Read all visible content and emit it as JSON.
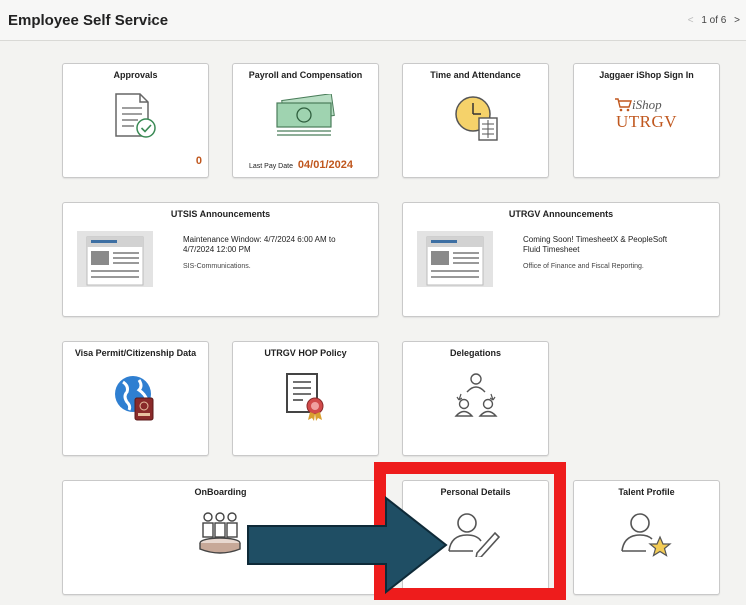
{
  "header": {
    "title": "Employee Self Service",
    "pager": "1 of 6"
  },
  "tiles": {
    "approvals": {
      "title": "Approvals",
      "count": "0"
    },
    "payroll": {
      "title": "Payroll and Compensation",
      "last_pay_label": "Last Pay Date",
      "last_pay_value": "04/01/2024"
    },
    "time": {
      "title": "Time and Attendance"
    },
    "jaggaer": {
      "title": "Jaggaer iShop Sign In",
      "logo_top": "iShop",
      "logo_bottom": "UTRGV"
    },
    "utsis": {
      "title": "UTSIS Announcements",
      "text": "Maintenance Window:  4/7/2024 6:00 AM to 4/7/2024 12:00 PM",
      "source": "SIS-Communications."
    },
    "utrgv_ann": {
      "title": "UTRGV Announcements",
      "text": "Coming Soon! TimesheetX & PeopleSoft Fluid Timesheet",
      "source": "Office of Finance and Fiscal Reporting."
    },
    "visa": {
      "title": "Visa Permit/Citizenship Data"
    },
    "hop": {
      "title": "UTRGV HOP Policy"
    },
    "delegations": {
      "title": "Delegations"
    },
    "onboarding": {
      "title": "OnBoarding"
    },
    "personal": {
      "title": "Personal Details"
    },
    "talent": {
      "title": "Talent Profile"
    }
  },
  "colors": {
    "highlight_box": "#ee1c1c",
    "arrow_fill": "#1f4e64",
    "amount": "#c0571e",
    "utrgv": "#c0571e"
  }
}
